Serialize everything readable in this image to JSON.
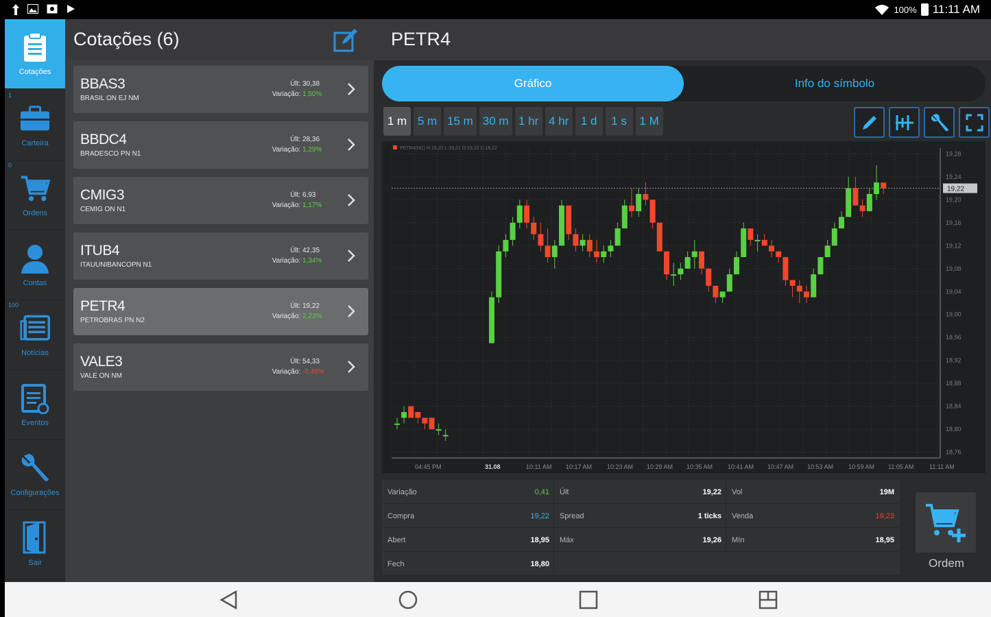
{
  "status_bar": {
    "battery": "100%",
    "time": "11:11 AM"
  },
  "nav": {
    "items": [
      {
        "label": "Cotações",
        "badge": "",
        "icon": "clipboard-icon"
      },
      {
        "label": "Carteira",
        "badge": "1",
        "icon": "briefcase-icon"
      },
      {
        "label": "Ordens",
        "badge": "0",
        "icon": "cart-icon"
      },
      {
        "label": "Contas",
        "badge": "",
        "icon": "person-icon"
      },
      {
        "label": "Notícias",
        "badge": "100",
        "icon": "news-icon"
      },
      {
        "label": "Eventos",
        "badge": "",
        "icon": "calendar-icon"
      },
      {
        "label": "Configurações",
        "badge": "",
        "icon": "wrench-icon"
      },
      {
        "label": "Sair",
        "badge": "",
        "icon": "door-icon"
      }
    ]
  },
  "quotes": {
    "title": "Cotações (6)",
    "ult_label": "Últ:",
    "var_label": "Variação:",
    "items": [
      {
        "symbol": "BBAS3",
        "name": "BRASIL ON EJ NM",
        "ult": "30,38",
        "var": "1,50%",
        "dir": "up"
      },
      {
        "symbol": "BBDC4",
        "name": "BRADESCO PN N1",
        "ult": "28,36",
        "var": "1,29%",
        "dir": "up"
      },
      {
        "symbol": "CMIG3",
        "name": "CEMIG ON N1",
        "ult": "6,93",
        "var": "1,17%",
        "dir": "up"
      },
      {
        "symbol": "ITUB4",
        "name": "ITAUUNIBANCOPN N1",
        "ult": "42,35",
        "var": "1,34%",
        "dir": "up"
      },
      {
        "symbol": "PETR4",
        "name": "PETROBRAS PN N2",
        "ult": "19,22",
        "var": "2,23%",
        "dir": "up"
      },
      {
        "symbol": "VALE3",
        "name": "VALE ON NM",
        "ult": "54,33",
        "var": "-0,46%",
        "dir": "down"
      }
    ]
  },
  "detail": {
    "title": "PETR4",
    "tabs": [
      "Gráfico",
      "Info do símbolo"
    ],
    "timeframes": [
      "1 m",
      "5 m",
      "15 m",
      "30 m",
      "1 hr",
      "4 hr",
      "1 d",
      "1 s",
      "1 M"
    ],
    "active_timeframe": "1 m",
    "tools": [
      "pencil-icon",
      "indicator-icon",
      "wrench-icon",
      "fullscreen-icon"
    ],
    "order_label": "Ordem"
  },
  "stats": {
    "rows": [
      [
        {
          "label": "Variação",
          "value": "0,41",
          "color": "green"
        },
        {
          "label": "Últ",
          "value": "19,22",
          "color": "white"
        },
        {
          "label": "Vol",
          "value": "19M",
          "color": "white"
        }
      ],
      [
        {
          "label": "Compra",
          "value": "19,22",
          "color": "blue"
        },
        {
          "label": "Spread",
          "value": "1 ticks",
          "color": "white"
        },
        {
          "label": "Venda",
          "value": "19,23",
          "color": "red"
        }
      ],
      [
        {
          "label": "Abert",
          "value": "18,95",
          "color": "white"
        },
        {
          "label": "Máx",
          "value": "19,26",
          "color": "white"
        },
        {
          "label": "Mín",
          "value": "18,95",
          "color": "white"
        }
      ],
      [
        {
          "label": "Fech",
          "value": "18,80",
          "color": "white"
        }
      ]
    ]
  },
  "chart_data": {
    "type": "candlestick",
    "legend": "PETR4(M1) H:19,20 L:19,21 O:19,22 C:19,22",
    "last_price": "19,22",
    "y_ticks": [
      "19,28",
      "19,24",
      "19,20",
      "19,16",
      "19,12",
      "19,08",
      "19,04",
      "19,00",
      "18,96",
      "18,92",
      "18,88",
      "18,84",
      "18,80",
      "18,76"
    ],
    "ylim": [
      18.75,
      19.29
    ],
    "x_ticks": [
      "04:45 PM",
      "31.08",
      "10:11 AM",
      "10:17 AM",
      "10:23 AM",
      "10:29 AM",
      "10:35 AM",
      "10:41 AM",
      "10:47 AM",
      "10:53 AM",
      "10:59 AM",
      "11:05 AM",
      "11:11 AM"
    ],
    "colors": {
      "up": "#58d143",
      "down": "#f0482b"
    },
    "candles": [
      [
        18.81,
        18.82,
        18.8,
        18.81
      ],
      [
        18.82,
        18.84,
        18.81,
        18.83
      ],
      [
        18.84,
        18.84,
        18.82,
        18.82
      ],
      [
        18.83,
        18.83,
        18.81,
        18.82
      ],
      [
        18.82,
        18.82,
        18.8,
        18.81
      ],
      [
        18.82,
        18.82,
        18.8,
        18.8
      ],
      [
        18.8,
        18.81,
        18.79,
        18.8
      ],
      [
        18.79,
        18.8,
        18.78,
        18.79
      ],
      [
        18.95,
        19.04,
        18.95,
        19.03
      ],
      [
        19.03,
        19.12,
        19.02,
        19.11
      ],
      [
        19.11,
        19.14,
        19.1,
        19.13
      ],
      [
        19.13,
        19.17,
        19.12,
        19.16
      ],
      [
        19.16,
        19.2,
        19.15,
        19.19
      ],
      [
        19.19,
        19.2,
        19.15,
        19.16
      ],
      [
        19.16,
        19.17,
        19.13,
        19.14
      ],
      [
        19.14,
        19.16,
        19.11,
        19.12
      ],
      [
        19.12,
        19.15,
        19.09,
        19.1
      ],
      [
        19.1,
        19.13,
        19.08,
        19.12
      ],
      [
        19.12,
        19.2,
        19.12,
        19.19
      ],
      [
        19.19,
        19.19,
        19.13,
        19.14
      ],
      [
        19.14,
        19.15,
        19.11,
        19.12
      ],
      [
        19.12,
        19.14,
        19.11,
        19.13
      ],
      [
        19.13,
        19.14,
        19.1,
        19.11
      ],
      [
        19.11,
        19.13,
        19.09,
        19.1
      ],
      [
        19.1,
        19.12,
        19.09,
        19.11
      ],
      [
        19.11,
        19.13,
        19.1,
        19.12
      ],
      [
        19.12,
        19.16,
        19.12,
        19.15
      ],
      [
        19.15,
        19.2,
        19.15,
        19.19
      ],
      [
        19.19,
        19.22,
        19.17,
        19.18
      ],
      [
        19.18,
        19.22,
        19.17,
        19.21
      ],
      [
        19.21,
        19.23,
        19.19,
        19.2
      ],
      [
        19.2,
        19.2,
        19.15,
        19.16
      ],
      [
        19.16,
        19.16,
        19.11,
        19.11
      ],
      [
        19.11,
        19.11,
        19.06,
        19.07
      ],
      [
        19.07,
        19.09,
        19.05,
        19.07
      ],
      [
        19.07,
        19.09,
        19.06,
        19.08
      ],
      [
        19.08,
        19.11,
        19.08,
        19.1
      ],
      [
        19.1,
        19.13,
        19.08,
        19.11
      ],
      [
        19.11,
        19.11,
        19.07,
        19.08
      ],
      [
        19.08,
        19.08,
        19.04,
        19.05
      ],
      [
        19.05,
        19.05,
        19.02,
        19.03
      ],
      [
        19.03,
        19.04,
        19.02,
        19.04
      ],
      [
        19.04,
        19.08,
        19.04,
        19.07
      ],
      [
        19.07,
        19.11,
        19.07,
        19.1
      ],
      [
        19.1,
        19.16,
        19.1,
        19.15
      ],
      [
        19.15,
        19.15,
        19.12,
        19.13
      ],
      [
        19.13,
        19.14,
        19.11,
        19.13
      ],
      [
        19.13,
        19.14,
        19.12,
        19.12
      ],
      [
        19.12,
        19.13,
        19.1,
        19.11
      ],
      [
        19.11,
        19.11,
        19.09,
        19.1
      ],
      [
        19.1,
        19.1,
        19.05,
        19.06
      ],
      [
        19.06,
        19.06,
        19.03,
        19.05
      ],
      [
        19.05,
        19.06,
        19.02,
        19.04
      ],
      [
        19.04,
        19.05,
        19.02,
        19.03
      ],
      [
        19.03,
        19.08,
        19.03,
        19.07
      ],
      [
        19.07,
        19.1,
        19.07,
        19.1
      ],
      [
        19.1,
        19.13,
        19.1,
        19.12
      ],
      [
        19.12,
        19.16,
        19.12,
        19.15
      ],
      [
        19.15,
        19.18,
        19.15,
        19.17
      ],
      [
        19.17,
        19.24,
        19.17,
        19.22
      ],
      [
        19.22,
        19.24,
        19.19,
        19.19
      ],
      [
        19.19,
        19.2,
        19.17,
        19.18
      ],
      [
        19.18,
        19.22,
        19.18,
        19.21
      ],
      [
        19.21,
        19.26,
        19.2,
        19.23
      ],
      [
        19.23,
        19.23,
        19.21,
        19.22
      ]
    ]
  },
  "sys_nav": [
    "back-icon",
    "home-icon",
    "recents-icon",
    "split-icon"
  ]
}
